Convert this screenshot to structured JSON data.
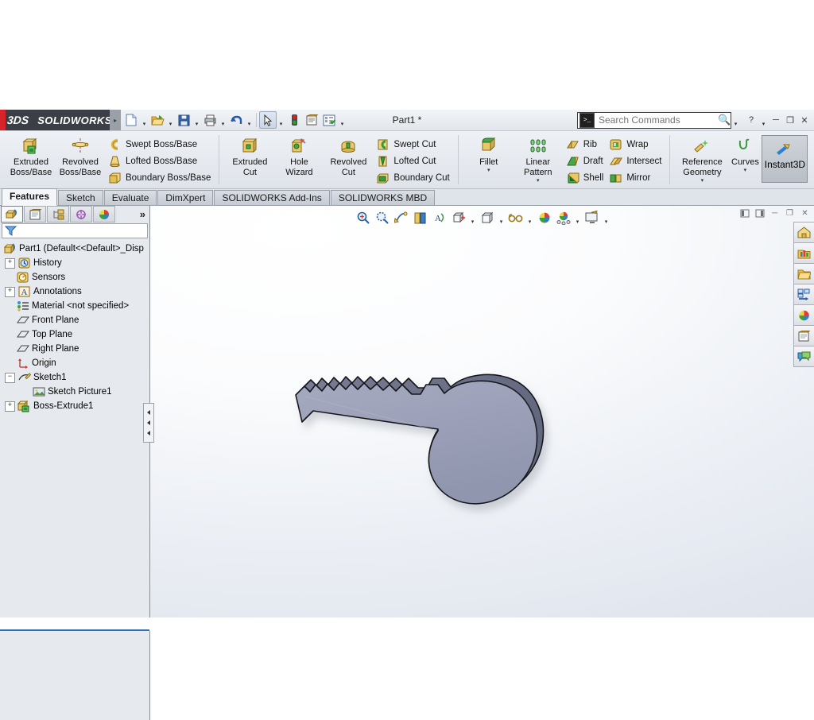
{
  "app": {
    "brand": "SOLIDWORKS",
    "brand_mark": "3DS",
    "document_title": "Part1 *"
  },
  "titlebar": {
    "quick_access": [
      {
        "name": "new-document",
        "icon": "new-doc-icon",
        "has_dropdown": true
      },
      {
        "name": "open-document",
        "icon": "open-folder-icon",
        "has_dropdown": true
      },
      {
        "name": "save-document",
        "icon": "save-disk-icon",
        "has_dropdown": true
      },
      {
        "name": "print-document",
        "icon": "printer-icon",
        "has_dropdown": true
      },
      {
        "name": "undo",
        "icon": "undo-arrow-icon",
        "has_dropdown": true
      },
      {
        "name": "select",
        "icon": "arrow-cursor-icon",
        "has_dropdown": true,
        "selected": true
      },
      {
        "name": "rebuild",
        "icon": "traffic-light-icon",
        "has_dropdown": false
      },
      {
        "name": "file-properties",
        "icon": "properties-sheet-icon",
        "has_dropdown": false
      },
      {
        "name": "options",
        "icon": "options-list-icon",
        "has_dropdown": true
      }
    ],
    "search": {
      "placeholder": "Search Commands",
      "value": "",
      "icon": "command-prompt-icon",
      "magnifier": "search-magnifier-icon"
    },
    "help_label": "?",
    "window_buttons": [
      "minimize",
      "restore",
      "close"
    ]
  },
  "ribbon": {
    "groups": [
      {
        "name": "boss-base",
        "big": [
          {
            "label_line1": "Extruded",
            "label_line2": "Boss/Base",
            "icon": "extruded-boss-icon"
          },
          {
            "label_line1": "Revolved",
            "label_line2": "Boss/Base",
            "icon": "revolved-boss-icon"
          }
        ],
        "small": [
          {
            "label": "Swept Boss/Base",
            "icon": "swept-boss-icon"
          },
          {
            "label": "Lofted Boss/Base",
            "icon": "lofted-boss-icon"
          },
          {
            "label": "Boundary Boss/Base",
            "icon": "boundary-boss-icon"
          }
        ]
      },
      {
        "name": "cut",
        "big": [
          {
            "label_line1": "Extruded",
            "label_line2": "Cut",
            "icon": "extruded-cut-icon"
          },
          {
            "label_line1": "Hole",
            "label_line2": "Wizard",
            "icon": "hole-wizard-icon"
          },
          {
            "label_line1": "Revolved",
            "label_line2": "Cut",
            "icon": "revolved-cut-icon"
          }
        ],
        "small": [
          {
            "label": "Swept Cut",
            "icon": "swept-cut-icon"
          },
          {
            "label": "Lofted Cut",
            "icon": "lofted-cut-icon"
          },
          {
            "label": "Boundary Cut",
            "icon": "boundary-cut-icon"
          }
        ]
      },
      {
        "name": "features",
        "big": [
          {
            "label_line1": "Fillet",
            "label_line2": "",
            "icon": "fillet-icon",
            "dropdown": "▾"
          },
          {
            "label_line1": "Linear",
            "label_line2": "Pattern",
            "icon": "linear-pattern-icon",
            "dropdown": "▾"
          }
        ],
        "small": [
          {
            "label": "Rib",
            "icon": "rib-icon"
          },
          {
            "label": "Draft",
            "icon": "draft-icon"
          },
          {
            "label": "Shell",
            "icon": "shell-icon"
          }
        ],
        "small2": [
          {
            "label": "Wrap",
            "icon": "wrap-icon"
          },
          {
            "label": "Intersect",
            "icon": "intersect-icon"
          },
          {
            "label": "Mirror",
            "icon": "mirror-icon"
          }
        ]
      },
      {
        "name": "reference",
        "big": [
          {
            "label_line1": "Reference",
            "label_line2": "Geometry",
            "icon": "reference-geometry-icon",
            "dropdown": "▾"
          },
          {
            "label_line1": "Curves",
            "label_line2": "",
            "icon": "curves-icon",
            "dropdown": "▾"
          }
        ],
        "toggle": {
          "label": "Instant3D",
          "icon": "instant3d-icon",
          "active": true
        }
      }
    ]
  },
  "command_tabs": [
    {
      "label": "Features",
      "active": true
    },
    {
      "label": "Sketch",
      "active": false
    },
    {
      "label": "Evaluate",
      "active": false
    },
    {
      "label": "DimXpert",
      "active": false
    },
    {
      "label": "SOLIDWORKS Add-Ins",
      "active": false
    },
    {
      "label": "SOLIDWORKS MBD",
      "active": false
    }
  ],
  "feature_manager": {
    "tabs": [
      {
        "name": "feature-manager-design-tree",
        "icon": "feature-tree-icon",
        "active": true
      },
      {
        "name": "property-manager",
        "icon": "property-manager-icon",
        "active": false
      },
      {
        "name": "configuration-manager",
        "icon": "configuration-manager-icon",
        "active": false
      },
      {
        "name": "dimxpert-manager",
        "icon": "dimxpert-manager-icon",
        "active": false
      },
      {
        "name": "display-manager",
        "icon": "display-manager-icon",
        "active": false
      }
    ],
    "more_label": "»",
    "filter": {
      "placeholder": "",
      "value": "",
      "icon": "filter-funnel-icon"
    },
    "tree": [
      {
        "label": "Part1  (Default<<Default>_Disp",
        "icon": "part-icon",
        "expander": "none",
        "indent": 0
      },
      {
        "label": "History",
        "icon": "history-clock-icon",
        "expander": "plus",
        "indent": 1
      },
      {
        "label": "Sensors",
        "icon": "sensors-icon",
        "expander": "none",
        "indent": 1
      },
      {
        "label": "Annotations",
        "icon": "annotations-icon",
        "expander": "plus",
        "indent": 1
      },
      {
        "label": "Material <not specified>",
        "icon": "material-icon",
        "expander": "none",
        "indent": 1
      },
      {
        "label": "Front Plane",
        "icon": "plane-icon",
        "expander": "none",
        "indent": 1
      },
      {
        "label": "Top Plane",
        "icon": "plane-icon",
        "expander": "none",
        "indent": 1
      },
      {
        "label": "Right Plane",
        "icon": "plane-icon",
        "expander": "none",
        "indent": 1
      },
      {
        "label": "Origin",
        "icon": "origin-icon",
        "expander": "none",
        "indent": 1
      },
      {
        "label": "Sketch1",
        "icon": "sketch-icon",
        "expander": "minus",
        "indent": 1
      },
      {
        "label": "Sketch Picture1",
        "icon": "sketch-picture-icon",
        "expander": "none",
        "indent": 2
      },
      {
        "label": "Boss-Extrude1",
        "icon": "boss-extrude-icon",
        "expander": "plus",
        "indent": 1
      }
    ]
  },
  "view_toolbar": [
    {
      "name": "zoom-to-fit",
      "icon": "zoom-fit-icon",
      "caret": false
    },
    {
      "name": "zoom-to-area",
      "icon": "zoom-area-icon",
      "caret": false
    },
    {
      "name": "previous-view",
      "icon": "previous-view-icon",
      "caret": false
    },
    {
      "name": "section-view",
      "icon": "section-view-icon",
      "caret": false
    },
    {
      "name": "view-orientation-annotations",
      "icon": "annotation-view-icon",
      "caret": false
    },
    {
      "name": "view-orientation",
      "icon": "view-orientation-cube-icon",
      "caret": true
    },
    {
      "name": "display-style",
      "icon": "display-style-cube-icon",
      "caret": true
    },
    {
      "name": "hide-show-items",
      "icon": "glasses-icon",
      "caret": true
    },
    {
      "name": "edit-appearance",
      "icon": "appearance-sphere-icon",
      "caret": false
    },
    {
      "name": "apply-scene",
      "icon": "scene-icon",
      "caret": true
    },
    {
      "name": "view-settings",
      "icon": "view-settings-icon",
      "caret": true
    }
  ],
  "document_window_buttons": [
    {
      "name": "restore-document-left",
      "icon": "dock-left-icon"
    },
    {
      "name": "restore-document-right",
      "icon": "dock-right-icon"
    },
    {
      "name": "minimize-document",
      "icon": "minimize-icon"
    },
    {
      "name": "restore-document",
      "icon": "restore-icon"
    },
    {
      "name": "close-document",
      "icon": "close-icon"
    }
  ],
  "task_pane": [
    {
      "name": "solidworks-resources",
      "icon": "home-icon"
    },
    {
      "name": "design-library",
      "icon": "design-library-icon"
    },
    {
      "name": "file-explorer",
      "icon": "folder-icon"
    },
    {
      "name": "view-palette",
      "icon": "view-palette-icon"
    },
    {
      "name": "appearances-scenes-decals",
      "icon": "appearances-sphere-icon"
    },
    {
      "name": "custom-properties",
      "icon": "custom-properties-icon"
    },
    {
      "name": "solidworks-forum",
      "icon": "forum-icon"
    }
  ],
  "model": {
    "name": "key-part",
    "description": "Extruded key body with toothed blade and round bow",
    "face_color": "#9ba0b8",
    "edge_color": "#1b1b1f",
    "side_color": "#6d7289"
  }
}
